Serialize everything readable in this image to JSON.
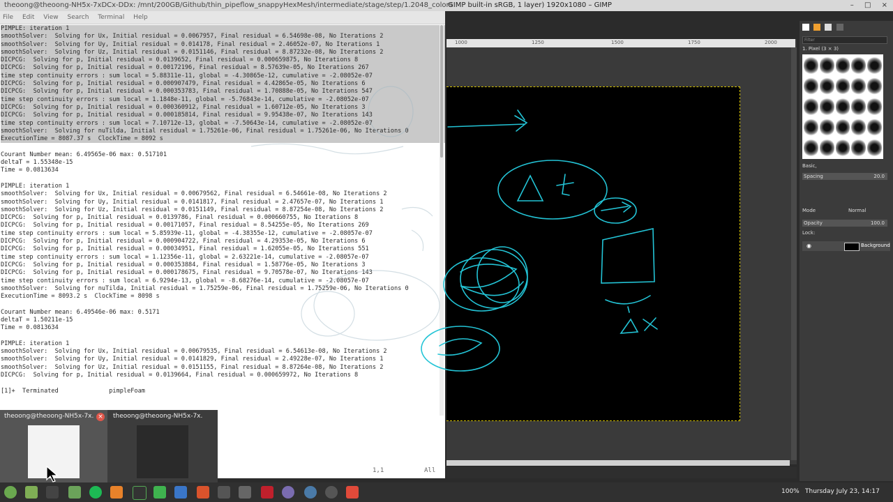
{
  "topbar": {
    "left_title": "theoong@theoong-NH5x-7xDCx-DDx: /mnt/200GB/Github/thin_pipeflow_snappyHexMesh/intermediate/stage/step/1.2048_colors",
    "gimp_title": "GIMP built-in sRGB, 1 layer) 1920x1080 – GIMP",
    "win_min": "–",
    "win_max": "□",
    "win_close": "×"
  },
  "terminal_menu": [
    "File",
    "Edit",
    "View",
    "Search",
    "Terminal",
    "Help"
  ],
  "terminal_lines": [
    "PIMPLE: iteration 1",
    "smoothSolver:  Solving for Ux, Initial residual = 0.0067957, Final residual = 6.54698e-08, No Iterations 2",
    "smoothSolver:  Solving for Uy, Initial residual = 0.014178, Final residual = 2.46052e-07, No Iterations 1",
    "smoothSolver:  Solving for Uz, Initial residual = 0.0151146, Final residual = 8.87232e-08, No Iterations 2",
    "DICPCG:  Solving for p, Initial residual = 0.0139652, Final residual = 0.000659875, No Iterations 8",
    "DICPCG:  Solving for p, Initial residual = 0.00172196, Final residual = 8.57639e-05, No Iterations 267",
    "time step continuity errors : sum local = 5.88311e-11, global = -4.30865e-12, cumulative = -2.08052e-07",
    "DICPCG:  Solving for p, Initial residual = 0.000907479, Final residual = 4.42865e-05, No Iterations 6",
    "DICPCG:  Solving for p, Initial residual = 0.000353783, Final residual = 1.70888e-05, No Iterations 547",
    "time step continuity errors : sum local = 1.1848e-11, global = -5.76843e-14, cumulative = -2.08052e-07",
    "DICPCG:  Solving for p, Initial residual = 0.000360912, Final residual = 1.60712e-05, No Iterations 3",
    "DICPCG:  Solving for p, Initial residual = 0.000185814, Final residual = 9.95438e-07, No Iterations 143",
    "time step continuity errors : sum local = 7.10712e-13, global = -7.50643e-14, cumulative = -2.08052e-07",
    "smoothSolver:  Solving for nuTilda, Initial residual = 1.75261e-06, Final residual = 1.75261e-06, No Iterations 0",
    "ExecutionTime = 8087.37 s  ClockTime = 8092 s",
    "",
    "Courant Number mean: 6.49565e-06 max: 0.517101",
    "deltaT = 1.55348e-15",
    "Time = 0.0813634",
    "",
    "PIMPLE: iteration 1",
    "smoothSolver:  Solving for Ux, Initial residual = 0.00679562, Final residual = 6.54661e-08, No Iterations 2",
    "smoothSolver:  Solving for Uy, Initial residual = 0.0141817, Final residual = 2.47657e-07, No Iterations 1",
    "smoothSolver:  Solving for Uz, Initial residual = 0.0151149, Final residual = 8.87254e-08, No Iterations 2",
    "DICPCG:  Solving for p, Initial residual = 0.0139786, Final residual = 0.000660755, No Iterations 8",
    "DICPCG:  Solving for p, Initial residual = 0.00171057, Final residual = 8.54255e-05, No Iterations 269",
    "time step continuity errors : sum local = 5.85939e-11, global = -4.38355e-12, cumulative = -2.08057e-07",
    "DICPCG:  Solving for p, Initial residual = 0.000904722, Final residual = 4.29353e-05, No Iterations 6",
    "DICPCG:  Solving for p, Initial residual = 0.00034951, Final residual = 1.62055e-05, No Iterations 551",
    "time step continuity errors : sum local = 1.12356e-11, global = 2.63221e-14, cumulative = -2.08057e-07",
    "DICPCG:  Solving for p, Initial residual = 0.000353884, Final residual = 1.58776e-05, No Iterations 3",
    "DICPCG:  Solving for p, Initial residual = 0.000178675, Final residual = 9.70578e-07, No Iterations 143",
    "time step continuity errors : sum local = 6.9294e-13, global = -8.68276e-14, cumulative = -2.08057e-07",
    "smoothSolver:  Solving for nuTilda, Initial residual = 1.75259e-06, Final residual = 1.75259e-06, No Iterations 0",
    "ExecutionTime = 8093.2 s  ClockTime = 8098 s",
    "",
    "Courant Number mean: 6.49546e-06 max: 0.5171",
    "deltaT = 1.50211e-15",
    "Time = 0.0813634",
    "",
    "PIMPLE: iteration 1",
    "smoothSolver:  Solving for Ux, Initial residual = 0.00679535, Final residual = 6.54613e-08, No Iterations 2",
    "smoothSolver:  Solving for Uy, Initial residual = 0.0141829, Final residual = 2.49228e-07, No Iterations 1",
    "smoothSolver:  Solving for Uz, Initial residual = 0.0151155, Final residual = 8.87264e-08, No Iterations 2",
    "DICPCG:  Solving for p, Initial residual = 0.0139664, Final residual = 0.000659972, No Iterations 8",
    "",
    "[1]+  Terminated              pimpleFoam"
  ],
  "terminal_status": {
    "position": "1,1",
    "scope": "All"
  },
  "ruler_ticks": [
    "1000",
    "1250",
    "1500",
    "1750",
    "2000"
  ],
  "dock": {
    "filter_label": "Filter",
    "brush_name": "1. Pixel (3 × 3)",
    "preset": "Basic,",
    "spacing_label": "Spacing",
    "spacing_value": "20.0",
    "mode_label": "Mode",
    "mode_value": "Normal",
    "opacity_label": "Opacity",
    "opacity_value": "100.0",
    "lock_label": "Lock:",
    "layer_name": "Background"
  },
  "switcher": [
    {
      "label": "theoong@theoong-NH5x-7x...",
      "active": true
    },
    {
      "label": "theoong@theoong-NH5x-7x...",
      "active": false
    }
  ],
  "tray": {
    "battery": "100%",
    "datetime": "Thursday July 23, 14:17"
  },
  "colors": {
    "sketch": "#23c4d6",
    "canvas": "#000000",
    "terminal_bg": "#ffffff",
    "taskbar": "#303030"
  }
}
